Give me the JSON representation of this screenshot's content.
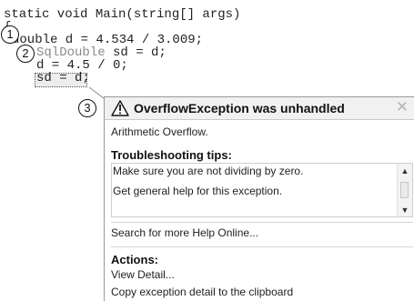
{
  "code": {
    "line1": "static void Main(string[] args)",
    "line2": "{",
    "line3": "double d = 4.534 / 3.009;",
    "line4_type": "SqlDouble",
    "line4_rest": " sd = d;",
    "line5": "d = 4.5 / 0;",
    "line6": "sd = d;"
  },
  "markers": [
    "①",
    "②",
    "③"
  ],
  "popup": {
    "title": "OverflowException was unhandled",
    "close_glyph": "✕",
    "message": "Arithmetic Overflow.",
    "tips_title": "Troubleshooting tips:",
    "tips": [
      "Make sure you are not dividing by zero.",
      "Get general help for this exception."
    ],
    "search_online": "Search for more Help Online...",
    "actions_title": "Actions:",
    "actions": [
      "View Detail...",
      "Copy exception detail to the clipboard"
    ]
  },
  "icons": {
    "warning": "warning-triangle-icon",
    "close": "close-icon",
    "scroll_up": "▲",
    "scroll_down": "▼"
  }
}
